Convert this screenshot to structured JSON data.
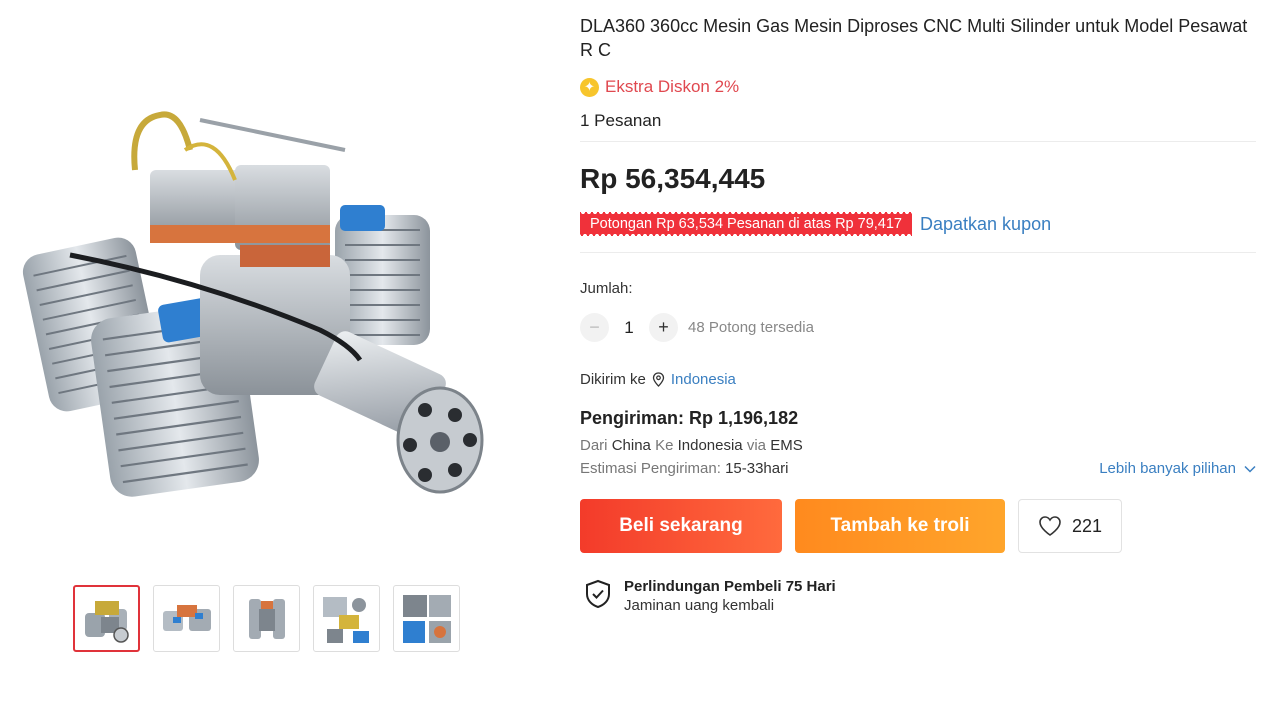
{
  "product": {
    "title": "DLA360 360cc Mesin Gas Mesin Diproses CNC Multi Silinder untuk Model Pesawat R C",
    "promo_icon": "star-badge-icon",
    "promo_text": "Ekstra Diskon 2%",
    "orders": "1 Pesanan",
    "price": "Rp 56,354,445",
    "coupon_text": "Potongan Rp 63,534 Pesanan di atas Rp 79,417",
    "coupon_link": "Dapatkan kupon"
  },
  "quantity": {
    "label": "Jumlah:",
    "minus": "−",
    "value": "1",
    "plus": "+",
    "stock": "48 Potong tersedia"
  },
  "shipping": {
    "ship_to_label": "Dikirim ke",
    "country": "Indonesia",
    "cost": "Pengiriman: Rp 1,196,182",
    "route_from_label": "Dari",
    "route_from": "China",
    "route_to_label": "Ke",
    "route_to": "Indonesia",
    "route_via_label": "via",
    "route_via": "EMS",
    "eta_label": "Estimasi Pengiriman:",
    "eta_value": "15-33hari",
    "more_options": "Lebih banyak pilihan"
  },
  "actions": {
    "buy_now": "Beli sekarang",
    "add_to_cart": "Tambah ke troli",
    "wishlist_count": "221"
  },
  "protection": {
    "title": "Perlindungan Pembeli 75 Hari",
    "subtitle": "Jaminan uang kembali"
  },
  "gallery": {
    "active_index": 0,
    "thumbnail_count": 5,
    "accent_color": "#e0333a"
  },
  "colors": {
    "buy_button": "#f33b2a",
    "cart_button": "#ff8a1e",
    "coupon_tag": "#f0313a",
    "link": "#3a7fc1",
    "promo": "#e0484f"
  }
}
